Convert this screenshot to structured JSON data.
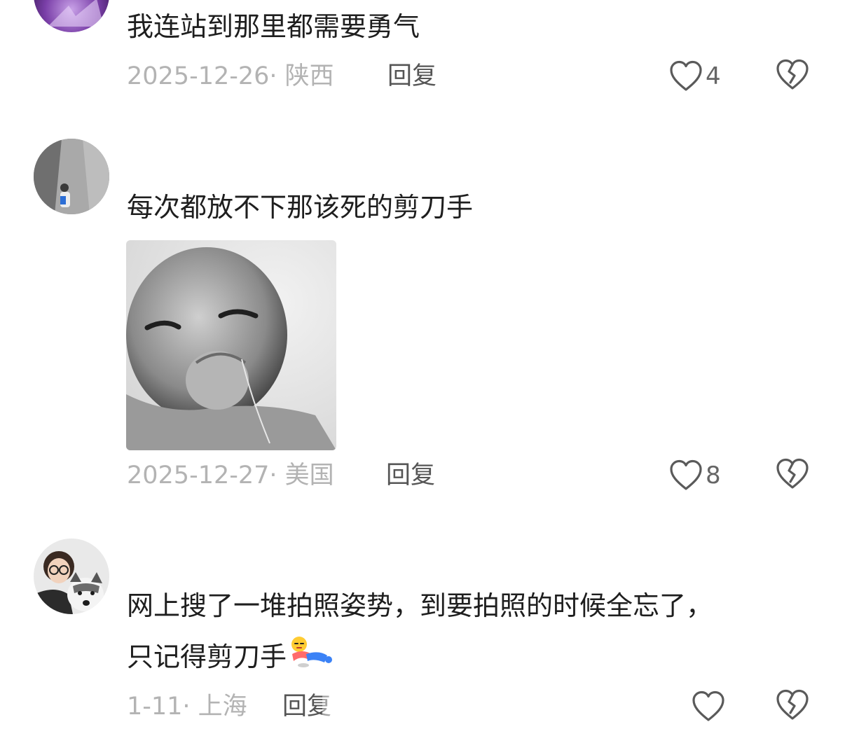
{
  "comments": [
    {
      "text": "我连站到那里都需要勇气",
      "date": "2025-12-26· 陕西",
      "reply": "回复",
      "likes": "4",
      "avatar_icon": "purple-avatar"
    },
    {
      "text": "每次都放不下那该死的剪刀手",
      "date": "2025-12-27· 美国",
      "reply": "回复",
      "likes": "8",
      "avatar_icon": "person-by-cliff-avatar",
      "image": "laughing-baby-photo"
    },
    {
      "text_line1": "网上搜了一堆拍照姿势，到要拍照的时候全忘了，",
      "text_line2": "只记得剪刀手",
      "emoji": "lying-down-emoji",
      "date": "1-11· 上海",
      "reply": "回复",
      "avatar_icon": "girl-with-husky-avatar"
    }
  ],
  "icons": {
    "like": "heart-outline-icon",
    "dislike": "broken-heart-icon"
  },
  "colors": {
    "meta_text": "#b3b3b3",
    "reply_text": "#555555",
    "icon_stroke": "#5a5a5a"
  }
}
